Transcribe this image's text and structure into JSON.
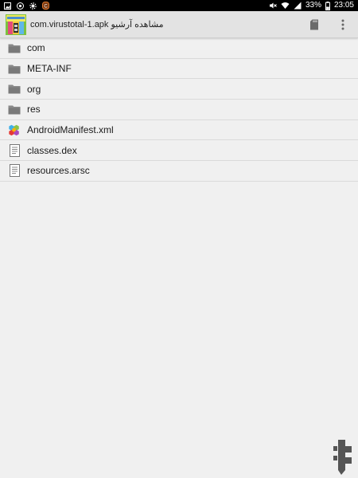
{
  "status_bar": {
    "battery_percent": "33%",
    "time": "23:05"
  },
  "toolbar": {
    "title": "com.virustotal-1.apk مشاهده آرشیو",
    "app_icon": "archive-app-icon",
    "actions": [
      "sd-card-icon",
      "more-vert-icon"
    ]
  },
  "files": [
    {
      "name": "com",
      "type": "folder"
    },
    {
      "name": "META-INF",
      "type": "folder"
    },
    {
      "name": "org",
      "type": "folder"
    },
    {
      "name": "res",
      "type": "folder"
    },
    {
      "name": "AndroidManifest.xml",
      "type": "xml"
    },
    {
      "name": "classes.dex",
      "type": "file"
    },
    {
      "name": "resources.arsc",
      "type": "file"
    }
  ]
}
